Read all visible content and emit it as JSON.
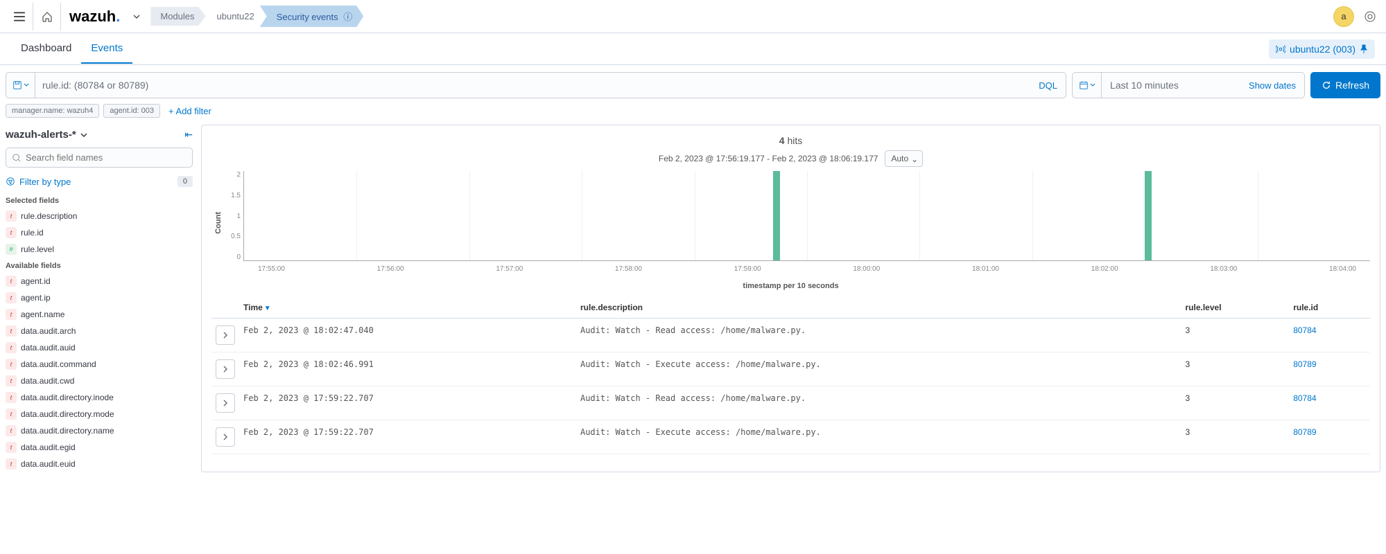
{
  "header": {
    "logo_main": "wazuh",
    "logo_dot": ".",
    "crumbs": [
      "Modules",
      "ubuntu22",
      "Security events"
    ],
    "avatar_letter": "a"
  },
  "tabs": {
    "items": [
      "Dashboard",
      "Events"
    ],
    "active": 1,
    "agent": "ubuntu22 (003)"
  },
  "search": {
    "query": "rule.id: (80784 or 80789)",
    "dql": "DQL",
    "time_range": "Last 10 minutes",
    "show_dates": "Show dates",
    "refresh": "Refresh"
  },
  "filters": {
    "chips": [
      "manager.name: wazuh4",
      "agent.id: 003"
    ],
    "add": "+ Add filter"
  },
  "sidebar": {
    "index": "wazuh-alerts-*",
    "field_search_placeholder": "Search field names",
    "filter_by_type": "Filter by type",
    "filter_count": "0",
    "selected_title": "Selected fields",
    "selected": [
      {
        "type": "t",
        "name": "rule.description"
      },
      {
        "type": "t",
        "name": "rule.id"
      },
      {
        "type": "n",
        "name": "rule.level"
      }
    ],
    "available_title": "Available fields",
    "available": [
      {
        "type": "t",
        "name": "agent.id"
      },
      {
        "type": "t",
        "name": "agent.ip"
      },
      {
        "type": "t",
        "name": "agent.name"
      },
      {
        "type": "t",
        "name": "data.audit.arch"
      },
      {
        "type": "t",
        "name": "data.audit.auid"
      },
      {
        "type": "t",
        "name": "data.audit.command"
      },
      {
        "type": "t",
        "name": "data.audit.cwd"
      },
      {
        "type": "t",
        "name": "data.audit.directory.inode"
      },
      {
        "type": "t",
        "name": "data.audit.directory.mode"
      },
      {
        "type": "t",
        "name": "data.audit.directory.name"
      },
      {
        "type": "t",
        "name": "data.audit.egid"
      },
      {
        "type": "t",
        "name": "data.audit.euid"
      }
    ]
  },
  "content": {
    "hits": "4",
    "hits_label": "hits",
    "chart_range": "Feb 2, 2023 @ 17:56:19.177 - Feb 2, 2023 @ 18:06:19.177",
    "interval": "Auto",
    "y_label": "Count",
    "x_label": "timestamp per 10 seconds",
    "columns": [
      "Time",
      "rule.description",
      "rule.level",
      "rule.id"
    ],
    "rows": [
      {
        "time": "Feb 2, 2023 @ 18:02:47.040",
        "desc": "Audit: Watch - Read access: /home/malware.py.",
        "level": "3",
        "id": "80784"
      },
      {
        "time": "Feb 2, 2023 @ 18:02:46.991",
        "desc": "Audit: Watch - Execute access: /home/malware.py.",
        "level": "3",
        "id": "80789"
      },
      {
        "time": "Feb 2, 2023 @ 17:59:22.707",
        "desc": "Audit: Watch - Read access: /home/malware.py.",
        "level": "3",
        "id": "80784"
      },
      {
        "time": "Feb 2, 2023 @ 17:59:22.707",
        "desc": "Audit: Watch - Execute access: /home/malware.py.",
        "level": "3",
        "id": "80789"
      }
    ]
  },
  "chart_data": {
    "type": "bar",
    "title": "",
    "xlabel": "timestamp per 10 seconds",
    "ylabel": "Count",
    "ylim": [
      0,
      2
    ],
    "y_ticks": [
      "2",
      "1.5",
      "1",
      "0.5",
      "0"
    ],
    "x_ticks": [
      "17:55:00",
      "17:56:00",
      "17:57:00",
      "17:58:00",
      "17:59:00",
      "18:00:00",
      "18:01:00",
      "18:02:00",
      "18:03:00",
      "18:04:00"
    ],
    "values": [
      {
        "x": "17:59:22",
        "count": 2,
        "pos_pct": 47
      },
      {
        "x": "18:02:47",
        "count": 2,
        "pos_pct": 80
      }
    ]
  }
}
